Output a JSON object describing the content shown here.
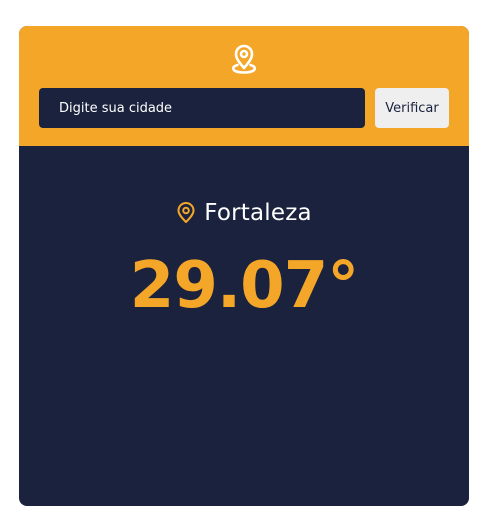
{
  "header": {
    "search": {
      "placeholder": "Digite sua cidade",
      "value": ""
    },
    "verify_label": "Verificar"
  },
  "weather": {
    "city": "Fortaleza",
    "temperature": "29.07°"
  },
  "icons": {
    "header": "location-pin-icon",
    "city": "location-pin-icon"
  },
  "colors": {
    "accent": "#f4a629",
    "background": "#1a223d",
    "button": "#efefef",
    "text": "#ffffff"
  }
}
